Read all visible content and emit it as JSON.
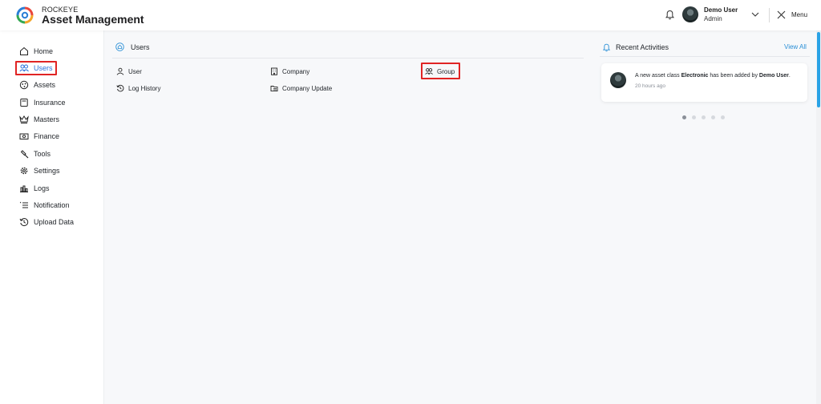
{
  "header": {
    "brand_small": "ROCKEYE",
    "brand_title": "Asset Management",
    "user_name": "Demo User",
    "user_role": "Admin",
    "menu_label": "Menu"
  },
  "sidebar": {
    "items": [
      {
        "label": "Home",
        "icon": "home-icon"
      },
      {
        "label": "Users",
        "icon": "users-icon",
        "active": true
      },
      {
        "label": "Assets",
        "icon": "assets-icon"
      },
      {
        "label": "Insurance",
        "icon": "insurance-icon"
      },
      {
        "label": "Masters",
        "icon": "crown-icon"
      },
      {
        "label": "Finance",
        "icon": "money-icon"
      },
      {
        "label": "Tools",
        "icon": "hammer-icon"
      },
      {
        "label": "Settings",
        "icon": "gear-icon"
      },
      {
        "label": "Logs",
        "icon": "bar-chart-icon"
      },
      {
        "label": "Notification",
        "icon": "list-icon"
      },
      {
        "label": "Upload Data",
        "icon": "history-icon"
      }
    ]
  },
  "main": {
    "breadcrumb": "Users",
    "options": [
      {
        "label": "User",
        "icon": "user-icon"
      },
      {
        "label": "Company",
        "icon": "building-icon"
      },
      {
        "label": "Group",
        "icon": "group-icon"
      },
      {
        "label": "Log History",
        "icon": "history-icon"
      },
      {
        "label": "Company Update",
        "icon": "folder-icon"
      }
    ]
  },
  "activities": {
    "title": "Recent Activities",
    "view_all": "View All",
    "item": {
      "text_before": "A new asset class ",
      "asset_class": "Electronic",
      "text_middle": " has been added by ",
      "actor": "Demo User",
      "text_after": ".",
      "time": "20 hours ago"
    },
    "pagination_count": 5,
    "active_page": 1
  },
  "colors": {
    "accent": "#2a6fdb",
    "link": "#2a8fd6",
    "highlight": "#e02424",
    "scroll_thumb": "#2aa3e6"
  }
}
